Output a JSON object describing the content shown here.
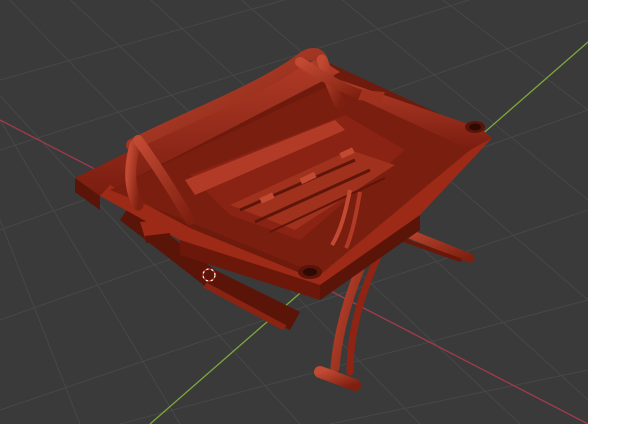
{
  "viewport": {
    "background": "#3a3a3a",
    "grid_color": "#474747",
    "x_axis_color": "#a23a4c",
    "y_axis_color": "#7fa63c",
    "model_color": "#8f2414",
    "model_highlight": "#b03a26",
    "model_shadow": "#5a1408",
    "cursor_icon": "3d-cursor"
  }
}
